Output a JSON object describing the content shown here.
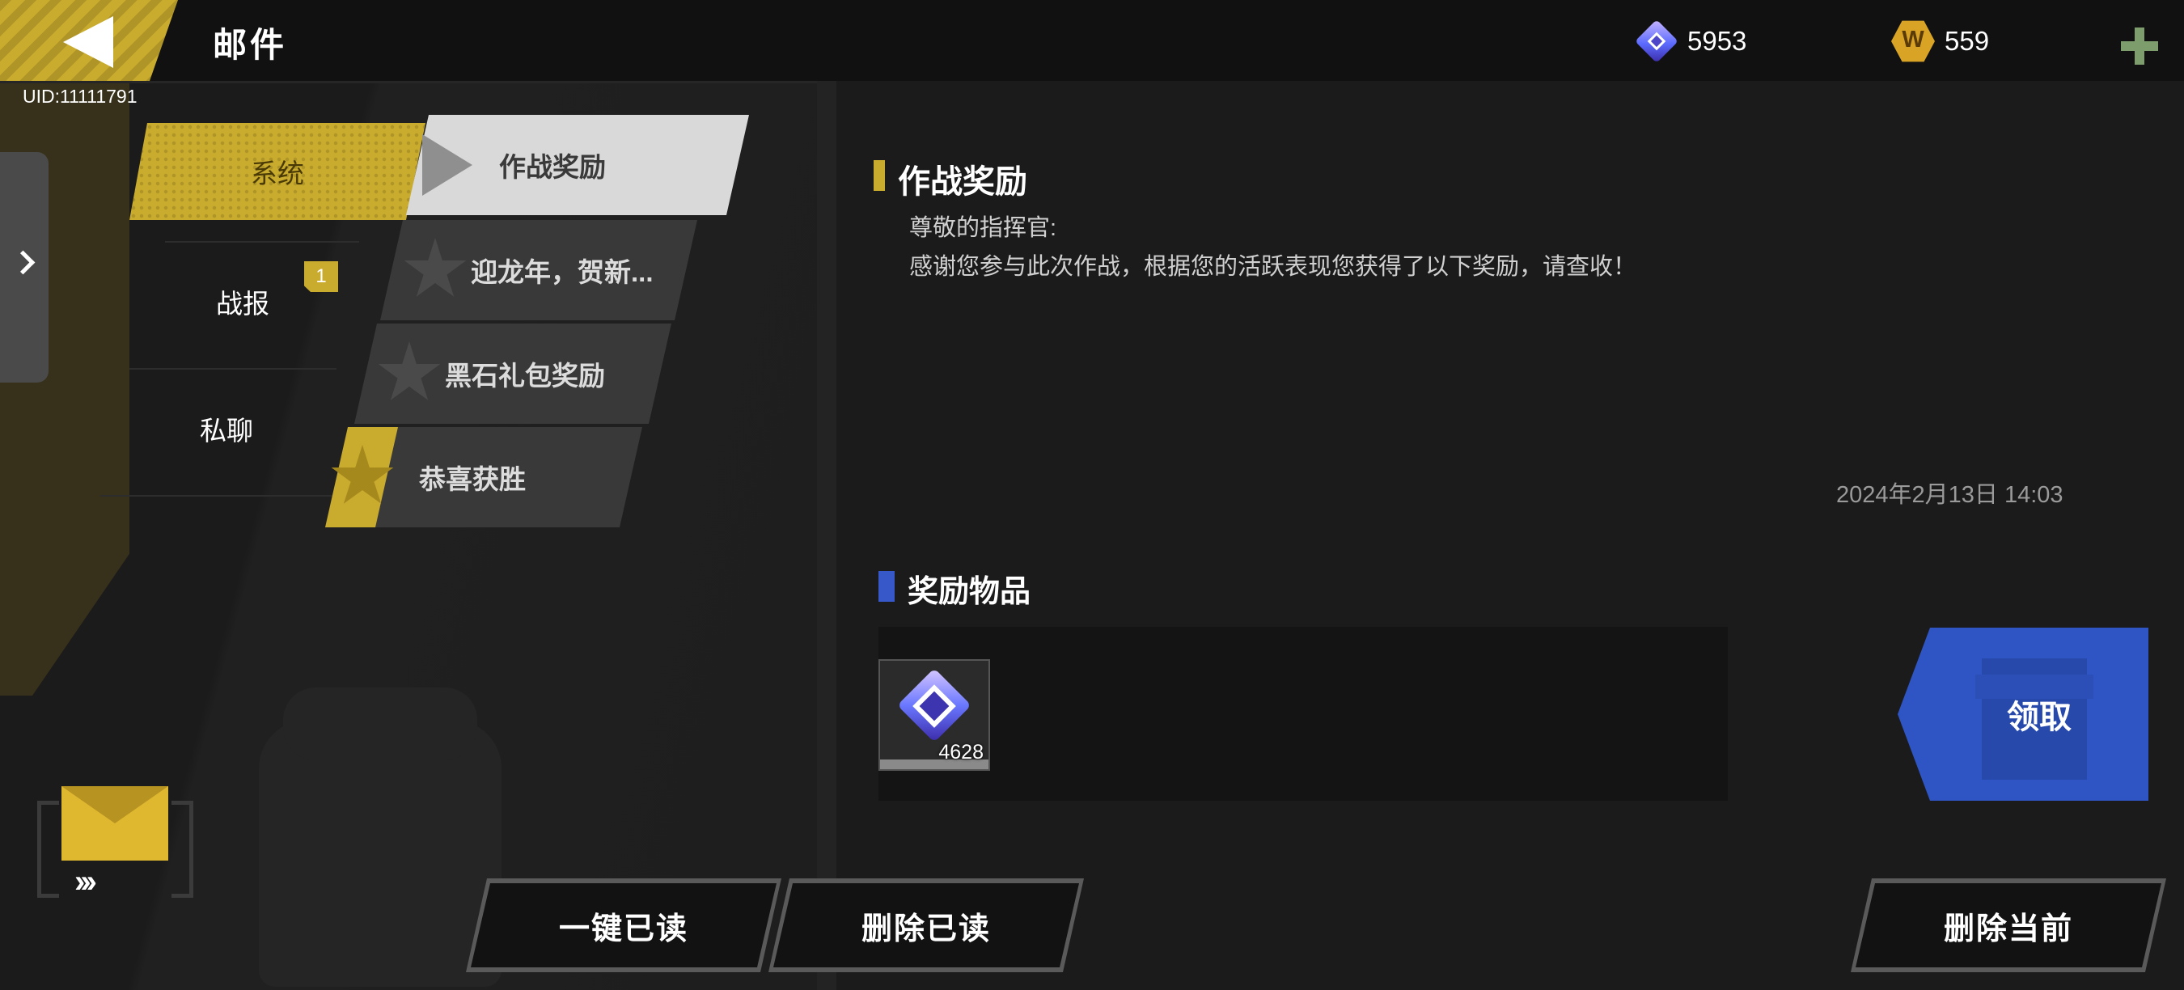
{
  "header": {
    "title": "邮件",
    "uid": "UID:11111791"
  },
  "currencies": {
    "gems": "5953",
    "coins": "559",
    "coin_letter": "W"
  },
  "categories": {
    "system": "系统",
    "report": "战报",
    "report_badge": "1",
    "private": "私聊"
  },
  "mails": [
    {
      "title": "作战奖励"
    },
    {
      "title": "迎龙年，贺新..."
    },
    {
      "title": "黑石礼包奖励"
    },
    {
      "title": "恭喜获胜"
    }
  ],
  "detail": {
    "title": "作战奖励",
    "greeting": "尊敬的指挥官:",
    "body": "感谢您参与此次作战，根据您的活跃表现您获得了以下奖励，请查收！",
    "timestamp": "2024年2月13日  14:03",
    "rewards_heading": "奖励物品",
    "reward_item_qty": "4628",
    "claim_label": "领取"
  },
  "buttons": {
    "read_all": "一键已读",
    "delete_read": "删除已读",
    "delete_current": "删除当前"
  },
  "colors": {
    "accent_gold": "#c9ab2e",
    "claim_blue": "#2f55c4",
    "reward_marker_blue": "#3658c9"
  }
}
